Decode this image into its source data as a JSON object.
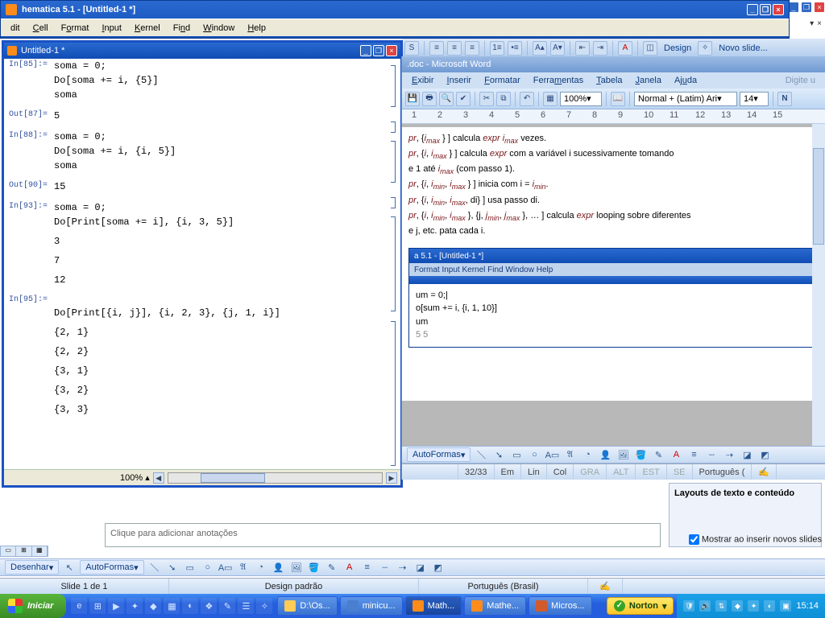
{
  "mathematica": {
    "mainTitle": "hematica 5.1 - [Untitled-1 *]",
    "menus": {
      "edit": "dit",
      "cell": "Cell",
      "format": "Format",
      "input": "Input",
      "kernel": "Kernel",
      "find": "Find",
      "window": "Window",
      "help": "Help"
    },
    "notebook": {
      "title": "Untitled-1 *",
      "zoom": "100%",
      "cells": [
        {
          "lbl": "In[85]:=",
          "lines": [
            "soma = 0;",
            "Do[soma += i, {5}]",
            "soma"
          ]
        },
        {
          "lbl": "Out[87]=",
          "lines": [
            "5"
          ]
        },
        {
          "lbl": "In[88]:=",
          "lines": [
            "soma = 0;",
            "Do[soma += i, {i, 5}]",
            "soma"
          ]
        },
        {
          "lbl": "Out[90]=",
          "lines": [
            "15"
          ]
        },
        {
          "lbl": "In[93]:=",
          "lines": [
            "soma = 0;",
            "Do[Print[soma += i], {i, 3, 5}]",
            "",
            "3",
            "",
            "7",
            "",
            "12"
          ]
        },
        {
          "lbl": "In[95]:=",
          "lines": [
            "",
            "Do[Print[{i, j}], {i, 2, 3}, {j, 1, i}]",
            "",
            "{2, 1}",
            "",
            "{2, 2}",
            "",
            "{3, 1}",
            "",
            "{3, 2}",
            "",
            "{3, 3}"
          ]
        }
      ]
    }
  },
  "pptToolbar": {
    "design": "Design",
    "newslide": "Novo slide..."
  },
  "word": {
    "titlebar": ".doc - Microsoft Word",
    "menus": {
      "exibir": "Exibir",
      "inserir": "Inserir",
      "formatar": "Formatar",
      "ferramentas": "Ferramentas",
      "tabela": "Tabela",
      "janela": "Janela",
      "ajuda": "Ajuda"
    },
    "hint": "Digite u",
    "zoom": "100%",
    "style": "Normal + (Latim) Ari",
    "fontsize": "14",
    "ruler": [
      "1",
      "2",
      "3",
      "4",
      "5",
      "6",
      "7",
      "8",
      "9",
      "10",
      "11",
      "12",
      "13",
      "14",
      "15"
    ],
    "body": {
      "l1a": "pr",
      "l1b": " } ] calcula ",
      "l1c": " vezes.",
      "l2a": "pr",
      "l2b": " } ]  calcula ",
      "l2c": " com a variável  i  sucessivamente tomando",
      "l3": "e 1 até ",
      "l3b": " (com passo 1).",
      "l4a": "pr",
      "l4b": " } ] inicia com  i = ",
      "l5a": "pr",
      "l5b": ", di} ] usa passo di.",
      "l6a": "pr",
      "l6b": " }, {j, ",
      "l6c": " }, … ] calcula ",
      "l6d": " looping sobre diferentes",
      "l7": "e j, etc. pata cada i.",
      "expr": "expr",
      "imax": "i",
      "max": "max",
      "imin": "i",
      "min": "min",
      "jmin": "j",
      "jmax": "j"
    },
    "screencap": {
      "title": "a 5.1 - [Untitled-1 *]",
      "menu": "Format  Input  Kernel  Find  Window  Help",
      "l1": "um = 0;|",
      "l2": "o[sum += i, {i, 1, 10}]",
      "l3": "um",
      "l4": "5 5"
    },
    "drawbar": {
      "autoshapes": "AutoFormas"
    },
    "status": {
      "pages": "32/33",
      "em": "Em",
      "lin": "Lin",
      "col": "Col",
      "gra": "GRA",
      "alt": "ALT",
      "est": "EST",
      "se": "SE",
      "lang": "Português ("
    }
  },
  "ppt": {
    "notesPlaceholder": "Clique para adicionar anotações",
    "layoutTitle": "Layouts de texto e conteúdo",
    "checkbox": "Mostrar ao inserir novos slides",
    "drawbar": {
      "draw": "Desenhar",
      "autoshapes": "AutoFormas"
    },
    "status": {
      "slide": "Slide 1 de 1",
      "design": "Design padrão",
      "lang": "Português (Brasil)"
    }
  },
  "taskbar": {
    "start": "Iniciar",
    "tasks": [
      {
        "label": "D:\\Os..."
      },
      {
        "label": "minicu..."
      },
      {
        "label": "Math..."
      },
      {
        "label": "Mathe..."
      },
      {
        "label": "Micros..."
      }
    ],
    "norton": "Norton",
    "clock": "15:14"
  }
}
